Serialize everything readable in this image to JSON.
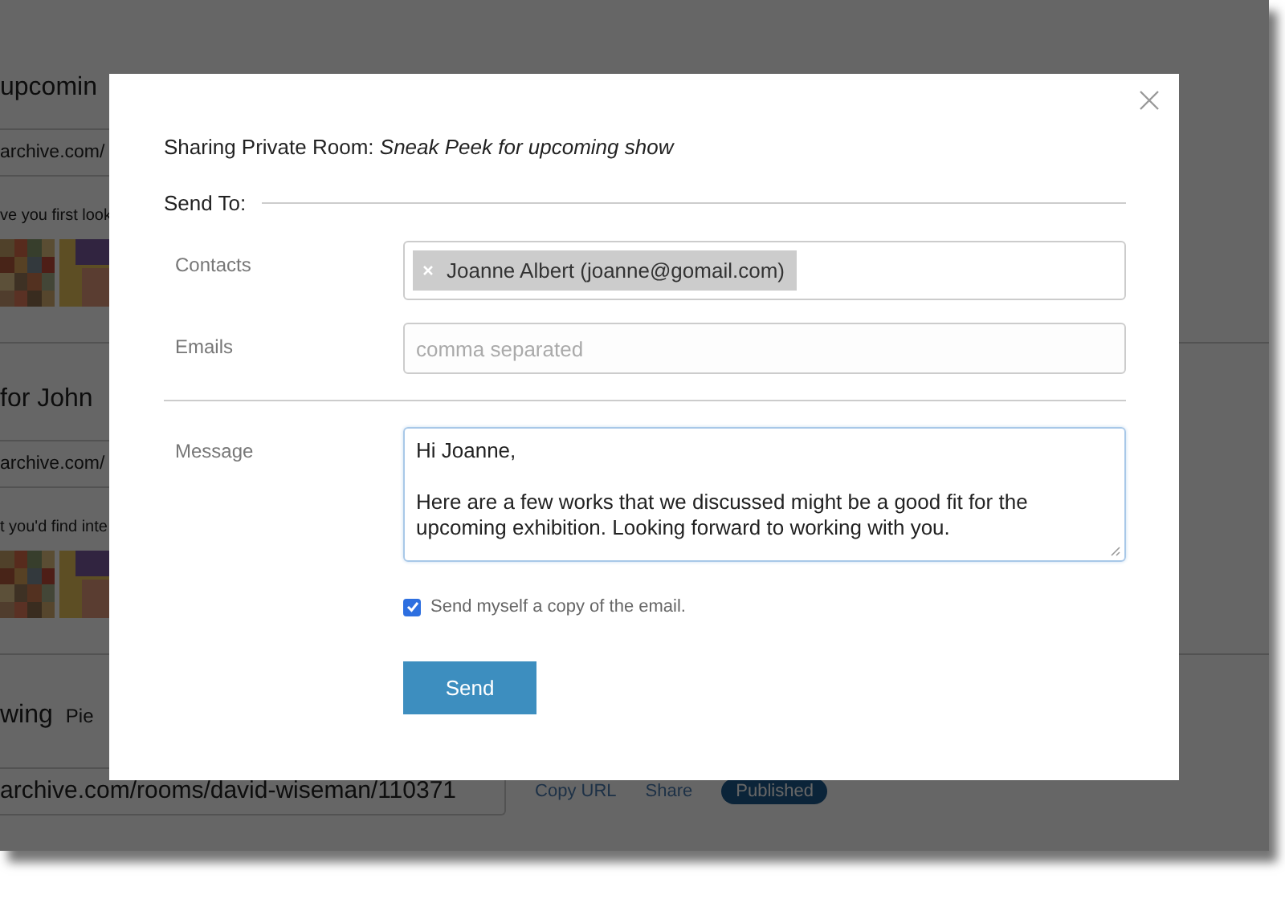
{
  "background_page": {
    "sections": [
      {
        "title": "upcomin",
        "url": "archive.com/",
        "description": "ve you first look",
        "thumbnails": [
          {
            "kind": "mosaic"
          },
          {
            "kind": "blocks"
          }
        ]
      },
      {
        "title": "for John",
        "url": "archive.com/",
        "description": "t you'd find inte",
        "thumbnails": [
          {
            "kind": "mosaic"
          },
          {
            "kind": "blocks"
          }
        ]
      }
    ],
    "last_section": {
      "title": "wing",
      "subtitle": "Pie",
      "url": "archive.com/rooms/david-wiseman/110371",
      "actions": [
        "Copy URL",
        "Share"
      ],
      "badge": "Published"
    }
  },
  "dialog": {
    "title": "Sharing Private Room: *Sneak Peek for upcoming show*",
    "section_label": "Send To:",
    "contacts": {
      "label": "Contacts",
      "chips": [
        "Joanne Albert (joanne@gomail.com)"
      ]
    },
    "emails": {
      "label": "Emails",
      "placeholder": "comma separated"
    },
    "message": {
      "label": "Message",
      "value": "Hi Joanne,\n\nHere are a few works that we discussed might be a good fit for the upcoming exhibition. Looking forward to working with you.",
      "focused": true
    },
    "copy_to_self": {
      "label": "Send myself a copy of the email.",
      "checked": true
    },
    "send_button": "Send"
  }
}
